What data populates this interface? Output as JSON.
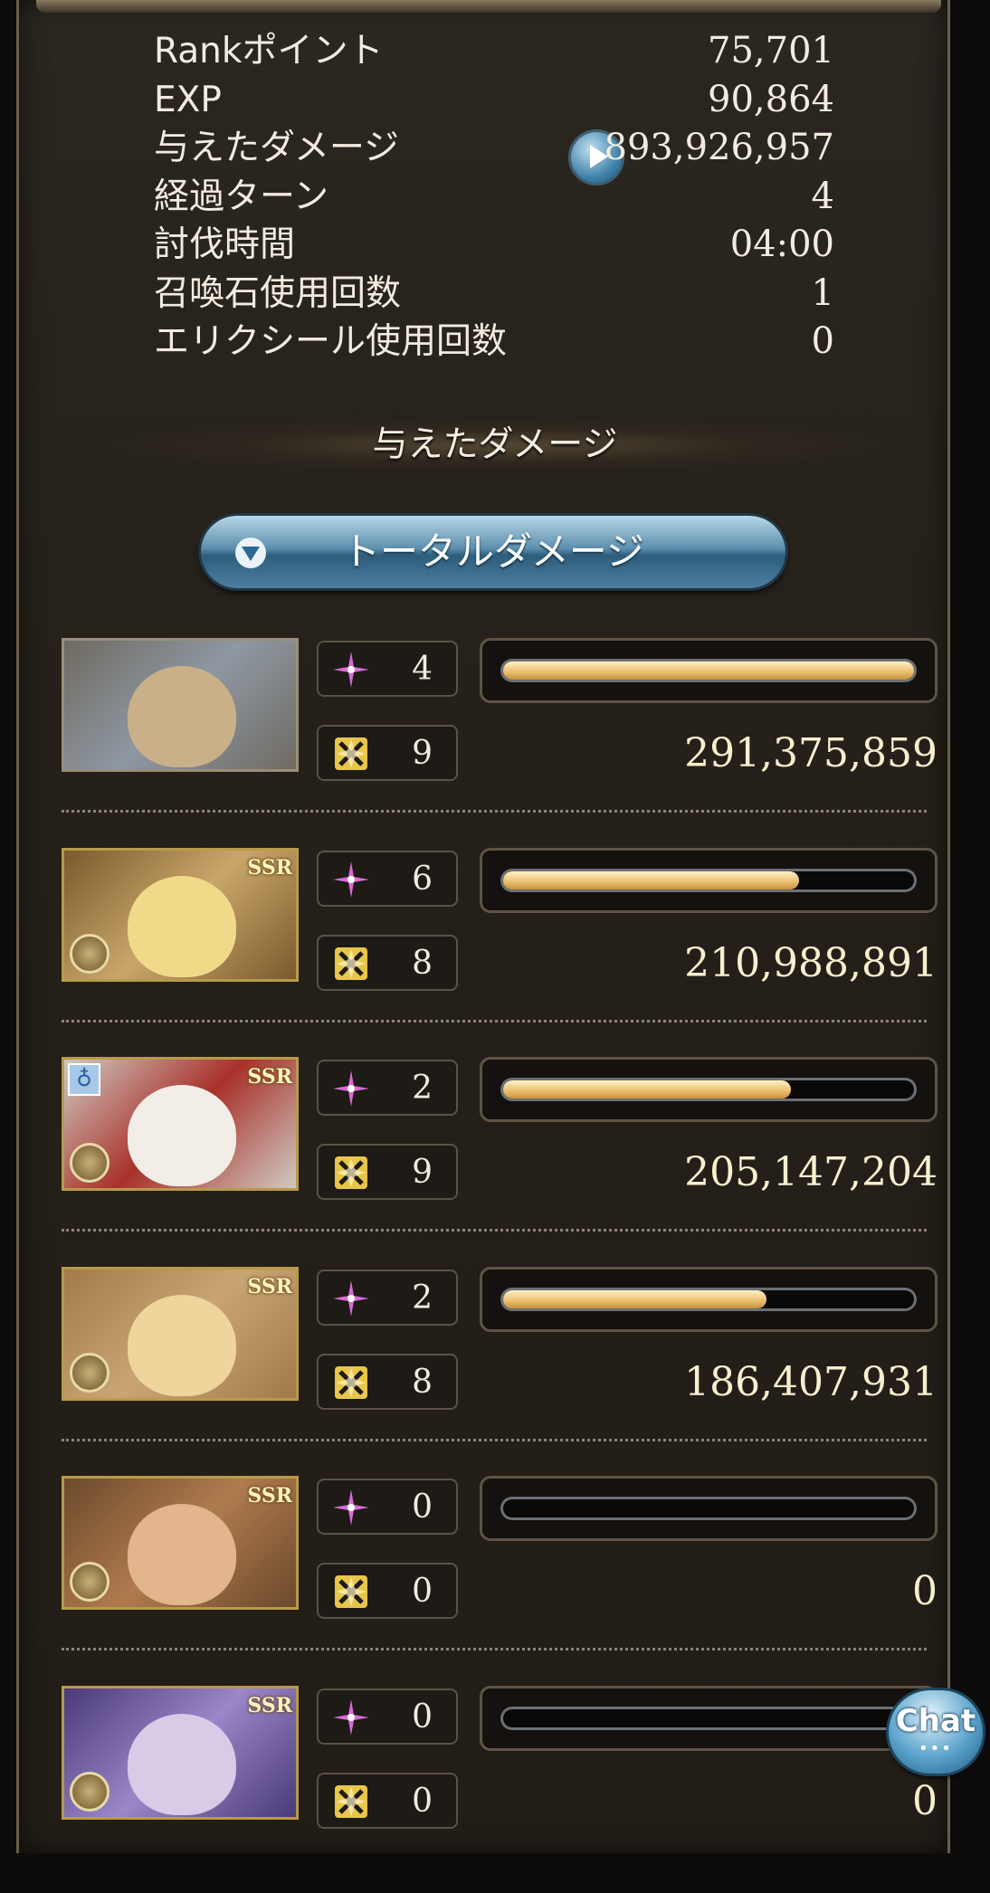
{
  "results": [
    {
      "label": "Rankポイント",
      "value": "75,701"
    },
    {
      "label": "EXP",
      "value": "90,864"
    },
    {
      "label": "与えたダメージ",
      "value": "893,926,957"
    },
    {
      "label": "経過ターン",
      "value": "4"
    },
    {
      "label": "討伐時間",
      "value": "04:00"
    },
    {
      "label": "召喚石使用回数",
      "value": "1"
    },
    {
      "label": "エリクシール使用回数",
      "value": "0"
    }
  ],
  "section": {
    "title": "与えたダメージ"
  },
  "dropdown": {
    "selected": "トータルダメージ"
  },
  "members": [
    {
      "ability_uses": "4",
      "ca_uses": "9",
      "damage": "291,375,859",
      "bar_fraction": 1.0,
      "ssr": "",
      "portrait_colors": [
        "#6f6a62",
        "#c9b089",
        "#8e98a2"
      ]
    },
    {
      "ability_uses": "6",
      "ca_uses": "8",
      "damage": "210,988,891",
      "bar_fraction": 0.72,
      "ssr": "SSR",
      "portrait_colors": [
        "#7a5a2c",
        "#f1d98a",
        "#c9a66a"
      ]
    },
    {
      "ability_uses": "2",
      "ca_uses": "9",
      "damage": "205,147,204",
      "bar_fraction": 0.7,
      "ssr": "SSR",
      "portrait_colors": [
        "#cfcac2",
        "#f2ede6",
        "#a8312a"
      ]
    },
    {
      "ability_uses": "2",
      "ca_uses": "8",
      "damage": "186,407,931",
      "bar_fraction": 0.64,
      "ssr": "SSR",
      "portrait_colors": [
        "#a27a4a",
        "#efd49c",
        "#c9a574"
      ]
    },
    {
      "ability_uses": "0",
      "ca_uses": "0",
      "damage": "0",
      "bar_fraction": 0.0,
      "ssr": "SSR",
      "portrait_colors": [
        "#6b4a2c",
        "#e2b58c",
        "#b07a4e"
      ]
    },
    {
      "ability_uses": "0",
      "ca_uses": "0",
      "damage": "0",
      "bar_fraction": 0.0,
      "ssr": "SSR",
      "portrait_colors": [
        "#4a3a78",
        "#d7cbe8",
        "#9a86c8"
      ]
    }
  ],
  "chat": {
    "label": "Chat",
    "dots": "•••"
  },
  "colors": {
    "ability_icon": "#d86ad6",
    "ca_icon": "#e8c64a",
    "bar_fill": "#e9bd6c"
  }
}
